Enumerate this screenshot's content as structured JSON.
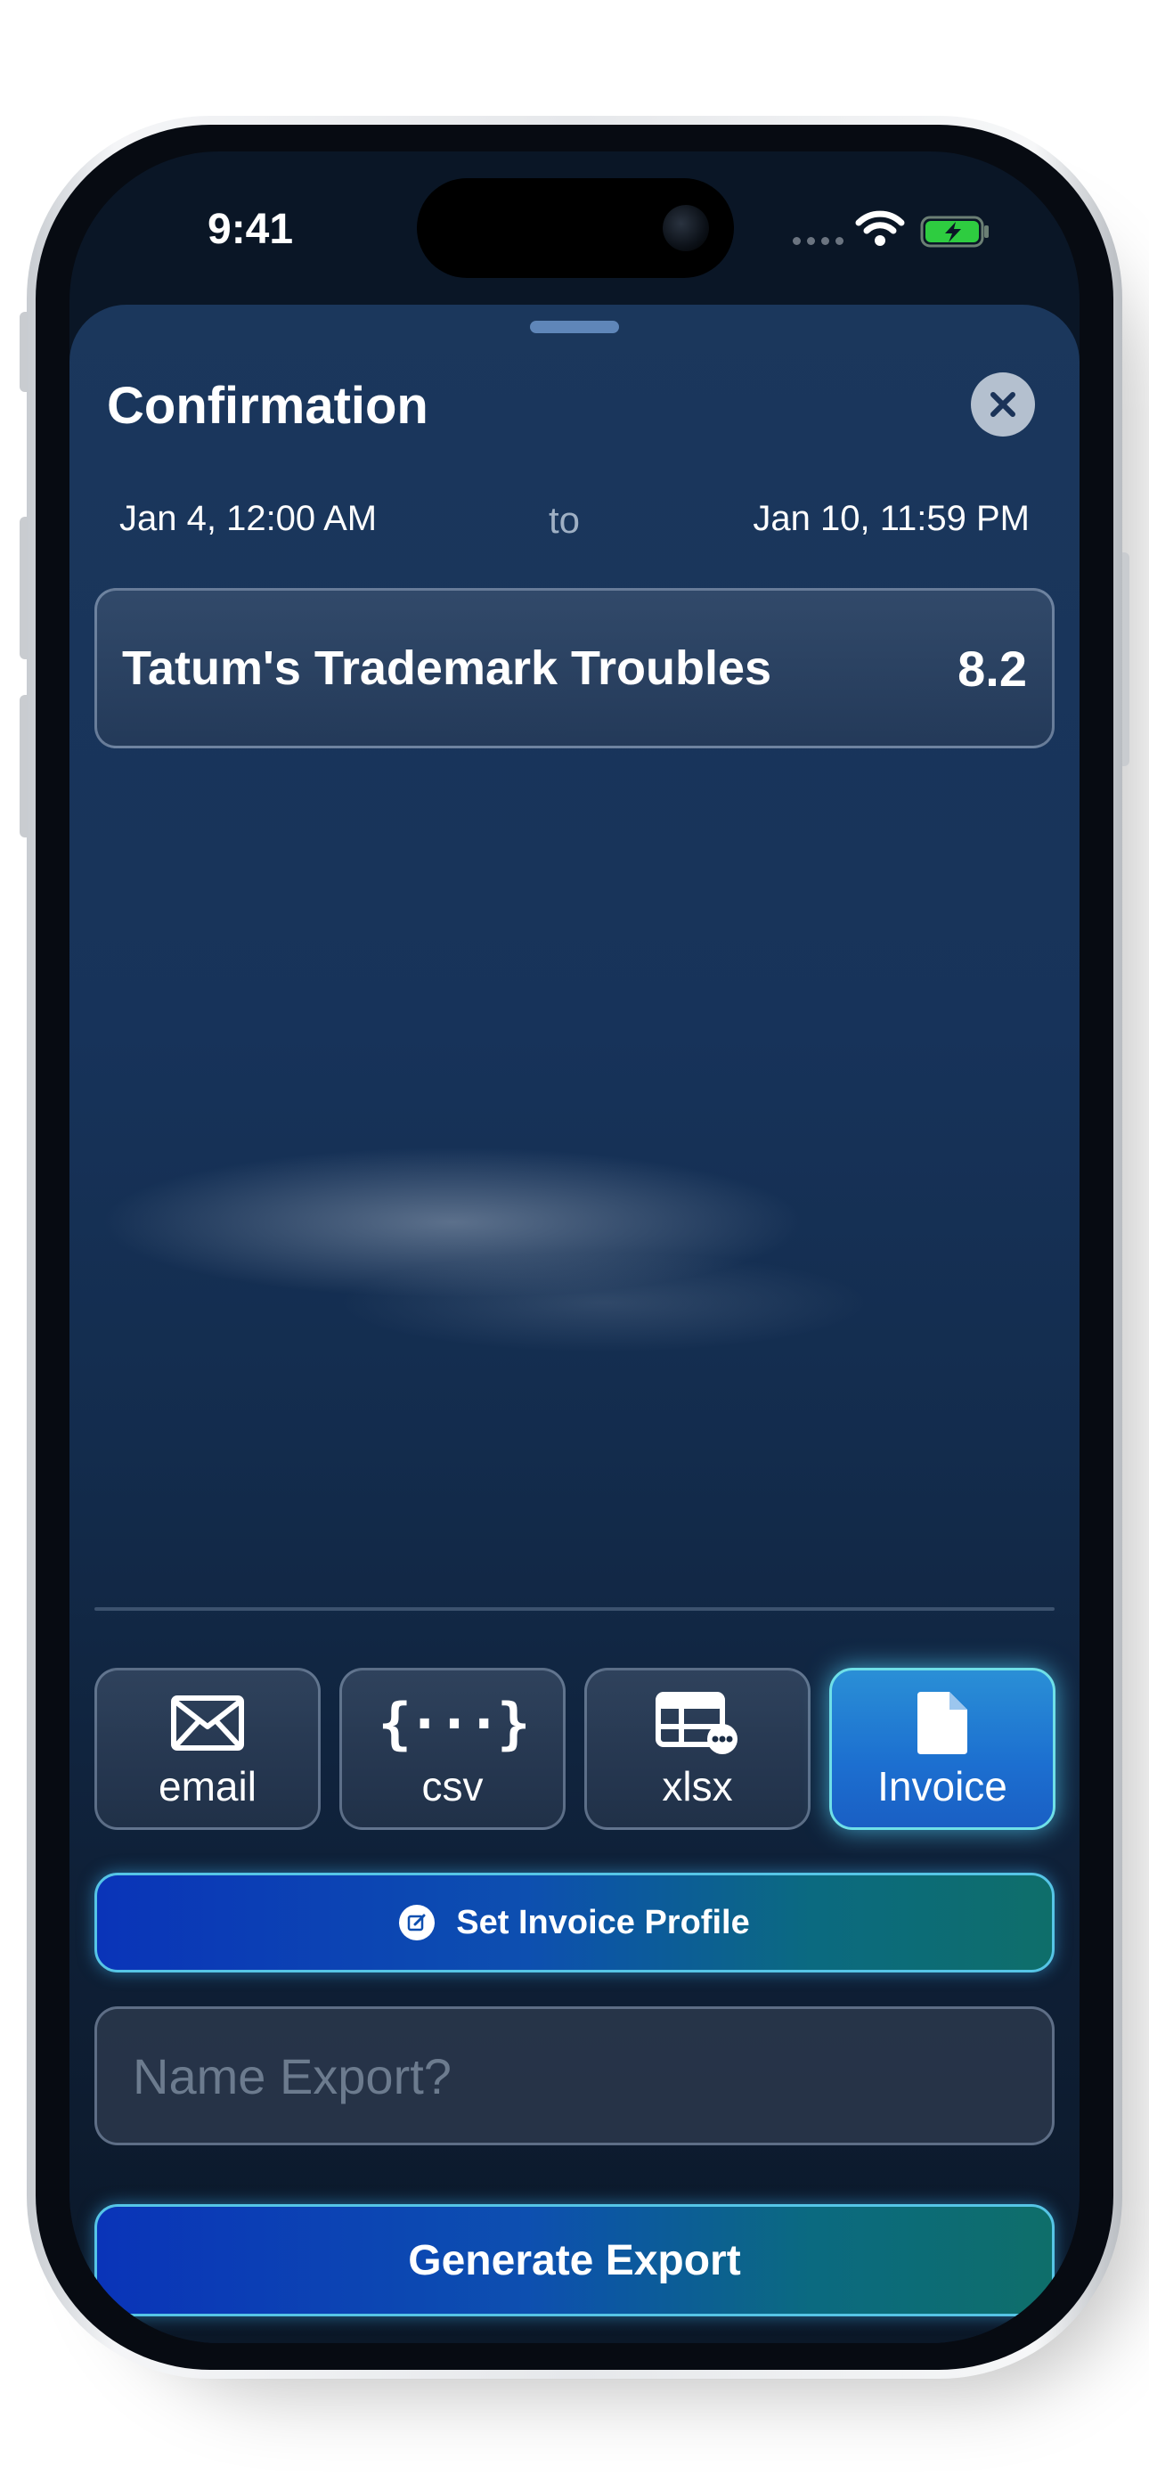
{
  "status_bar": {
    "time": "9:41",
    "icons": [
      "signal-dots-icon",
      "wifi-icon",
      "battery-charging-icon"
    ],
    "battery_color": "#2ecc40"
  },
  "sheet": {
    "title": "Confirmation",
    "close_icon": "close-icon",
    "date_start": "Jan 4, 12:00 AM",
    "date_separator": "to",
    "date_end": "Jan 10, 11:59 PM",
    "projects": [
      {
        "name": "Tatum's Trademark Troubles",
        "hours": "8.2"
      }
    ],
    "formats": [
      {
        "label": "email",
        "icon": "envelope-icon",
        "selected": false
      },
      {
        "label": "csv",
        "icon": "curly-braces-icon",
        "selected": false
      },
      {
        "label": "xlsx",
        "icon": "table-icon",
        "selected": false
      },
      {
        "label": "Invoice",
        "icon": "document-icon",
        "selected": true
      }
    ],
    "profile_button": {
      "label": "Set Invoice Profile",
      "icon": "edit-icon"
    },
    "name_input": {
      "placeholder": "Name Export?",
      "value": ""
    },
    "generate_button": {
      "label": "Generate Export"
    }
  },
  "colors": {
    "accent_blue": "#0a34b8",
    "accent_teal": "#0e6e6a",
    "glow": "#56c5e6",
    "sheet_bg": "#17335a"
  }
}
